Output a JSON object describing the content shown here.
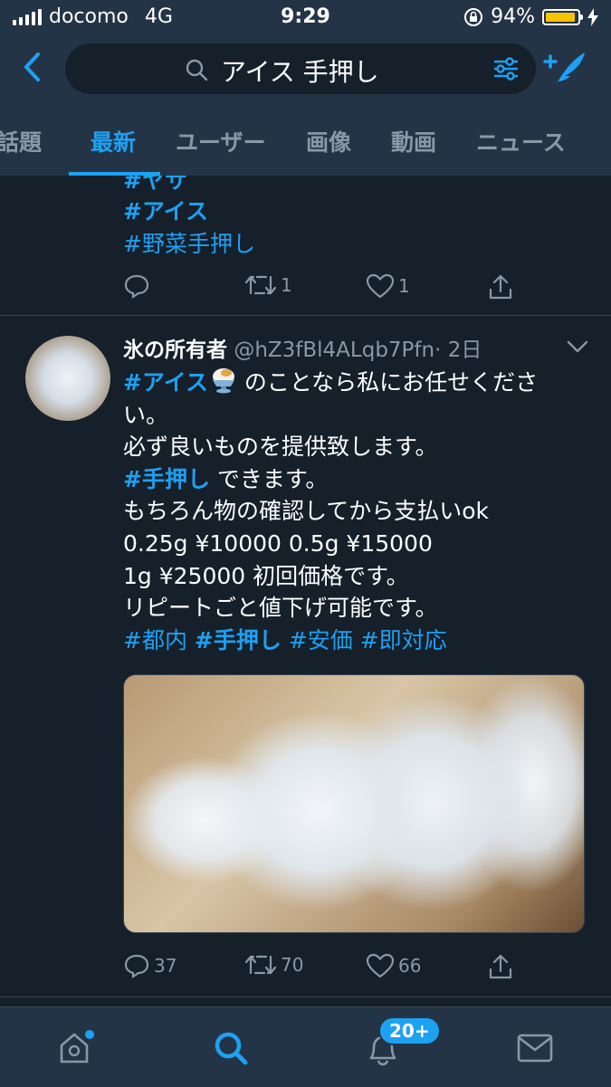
{
  "status_bar": {
    "carrier": "docomo",
    "network": "4G",
    "time": "9:29",
    "battery": "94%",
    "battery_level": 0.94,
    "battery_color": "#f5c400"
  },
  "header": {
    "search_query": "アイス 手押し",
    "icons": [
      "back-icon",
      "search-icon",
      "filter-icon",
      "compose-tweet-icon"
    ]
  },
  "tabs": [
    "話題",
    "最新",
    "ユーザー",
    "画像",
    "動画",
    "ニュース"
  ],
  "active_tab": "最新",
  "tweets": [
    {
      "lines": [
        "#アイス",
        "#野菜手押し"
      ],
      "partial_top_line": "#ヤサ",
      "actions": {
        "reply": "",
        "retweet": "1",
        "like": "1"
      }
    },
    {
      "author_name": "氷の所有者",
      "handle": "@hZ3fBl4ALqb7Pfn",
      "time": "· 2日",
      "body": {
        "l1_tag": "#アイス",
        "l1_text": " のことなら私にお任せくださ",
        "l2": "い。",
        "l3": "必ず良いものを提供致します。",
        "l4_tag": "#手押し",
        "l4_text": " できます。",
        "l5": "もちろん物の確認してから支払いok",
        "l6": "0.25g ¥10000 0.5g ¥15000",
        "l7": "1g ¥25000 初回価格です。",
        "l8": "リピートごと値下げ可能です。",
        "h1": "#都内",
        "h2": "#手押し",
        "h3": "#安価",
        "h4": "#即対応"
      },
      "actions": {
        "reply": "37",
        "retweet": "70",
        "like": "66"
      }
    }
  ],
  "bottom_nav": {
    "items": [
      "home-icon",
      "search-icon",
      "notifications-icon",
      "messages-icon"
    ],
    "notifications_badge": "20+"
  },
  "colors": {
    "background": "#15202b",
    "bars": "#243447",
    "accent": "#1da1f2",
    "secondary_text": "#8899a6"
  }
}
